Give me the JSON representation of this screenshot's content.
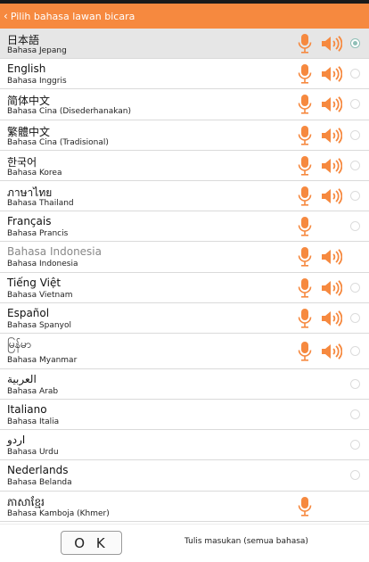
{
  "header": {
    "title": "Pilih bahasa lawan bicara"
  },
  "languages": [
    {
      "native": "日本語",
      "translated": "Bahasa Jepang",
      "mic": true,
      "speaker": true,
      "radio": "on",
      "selected": true
    },
    {
      "native": "English",
      "translated": "Bahasa Inggris",
      "mic": true,
      "speaker": true,
      "radio": "off"
    },
    {
      "native": "简体中文",
      "translated": "Bahasa Cina (Disederhanakan)",
      "mic": true,
      "speaker": true,
      "radio": "off"
    },
    {
      "native": "繁體中文",
      "translated": "Bahasa Cina (Tradisional)",
      "mic": true,
      "speaker": true,
      "radio": "off"
    },
    {
      "native": "한국어",
      "translated": "Bahasa Korea",
      "mic": true,
      "speaker": true,
      "radio": "off"
    },
    {
      "native": "ภาษาไทย",
      "translated": "Bahasa Thailand",
      "mic": true,
      "speaker": true,
      "radio": "off"
    },
    {
      "native": "Français",
      "translated": "Bahasa Prancis",
      "mic": true,
      "speaker": false,
      "radio": "off"
    },
    {
      "native": "Bahasa Indonesia",
      "translated": "Bahasa Indonesia",
      "mic": true,
      "speaker": true,
      "radio": "none",
      "dim": true
    },
    {
      "native": "Tiếng Việt",
      "translated": "Bahasa Vietnam",
      "mic": true,
      "speaker": true,
      "radio": "off"
    },
    {
      "native": "Español",
      "translated": "Bahasa Spanyol",
      "mic": true,
      "speaker": true,
      "radio": "off"
    },
    {
      "native": "မြန်မာ",
      "translated": "Bahasa Myanmar",
      "mic": true,
      "speaker": true,
      "radio": "off",
      "tall": true
    },
    {
      "native": "العربية",
      "translated": "Bahasa Arab",
      "mic": false,
      "speaker": false,
      "radio": "off"
    },
    {
      "native": "Italiano",
      "translated": "Bahasa Italia",
      "mic": false,
      "speaker": false,
      "radio": "off"
    },
    {
      "native": "اردو",
      "translated": "Bahasa Urdu",
      "mic": false,
      "speaker": false,
      "radio": "off"
    },
    {
      "native": "Nederlands",
      "translated": "Bahasa Belanda",
      "mic": false,
      "speaker": false,
      "radio": "off"
    },
    {
      "native": "ភាសាខ្មែរ",
      "translated": "Bahasa Kamboja (Khmer)",
      "mic": true,
      "speaker": false,
      "radio": "none"
    }
  ],
  "footer": {
    "ok_label": "O K",
    "manual_input_label": "Tulis masukan (semua bahasa)"
  },
  "colors": {
    "accent": "#f6893f",
    "radio_selected": "#8fbfb7"
  },
  "icons": {
    "mic": "microphone-icon",
    "speaker": "speaker-icon",
    "back": "chevron-left-icon"
  }
}
